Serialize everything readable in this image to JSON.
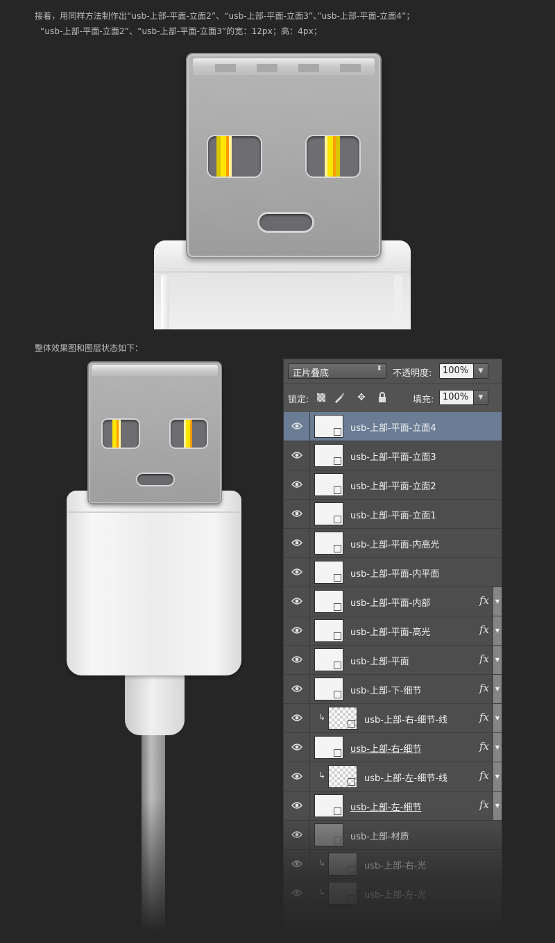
{
  "intro": {
    "line1": "接着，用同样方法制作出“usb-上部-平面-立面2”、“usb-上部-平面-立面3”、”usb-上部-平面-立面4”；",
    "line2": "“usb-上部-平面-立面2”、“usb-上部-平面-立面3”的宽：12px；高：4px；"
  },
  "caption": "整体效果图和图层状态如下：",
  "colors": {
    "background": "#262626",
    "panel": "#535353",
    "selected_row": "#6a7d95",
    "pin_yellow": "#ffe600",
    "pin_orange": "#ff9a00"
  },
  "layers_panel": {
    "blend_mode": "正片叠底",
    "opacity_label": "不透明度:",
    "opacity_value": "100%",
    "lock_label": "锁定:",
    "fill_label": "填充:",
    "fill_value": "100%",
    "lock_icons": [
      "lock-transparency-icon",
      "brush-icon",
      "move-icon",
      "padlock-icon"
    ],
    "layers": [
      {
        "name": "usb-上部-平面-立面4",
        "selected": true,
        "fx": false,
        "clipped": false,
        "thumb": "white"
      },
      {
        "name": "usb-上部-平面-立面3",
        "selected": false,
        "fx": false,
        "clipped": false,
        "thumb": "white"
      },
      {
        "name": "usb-上部-平面-立面2",
        "selected": false,
        "fx": false,
        "clipped": false,
        "thumb": "white"
      },
      {
        "name": "usb-上部-平面-立面1",
        "selected": false,
        "fx": false,
        "clipped": false,
        "thumb": "white"
      },
      {
        "name": "usb-上部-平面-内高光",
        "selected": false,
        "fx": false,
        "clipped": false,
        "thumb": "white"
      },
      {
        "name": "usb-上部-平面-内平面",
        "selected": false,
        "fx": false,
        "clipped": false,
        "thumb": "white"
      },
      {
        "name": "usb-上部-平面-内部",
        "selected": false,
        "fx": true,
        "clipped": false,
        "thumb": "white"
      },
      {
        "name": "usb-上部-平面-高光",
        "selected": false,
        "fx": true,
        "clipped": false,
        "thumb": "white"
      },
      {
        "name": "usb-上部-平面",
        "selected": false,
        "fx": true,
        "clipped": false,
        "thumb": "white"
      },
      {
        "name": "usb-上部-下-细节",
        "selected": false,
        "fx": true,
        "clipped": false,
        "thumb": "white"
      },
      {
        "name": "usb-上部-右-细节-线",
        "selected": false,
        "fx": true,
        "clipped": true,
        "thumb": "checker"
      },
      {
        "name": "usb-上部-右-细节",
        "selected": false,
        "fx": true,
        "clipped": false,
        "thumb": "white",
        "underline": true
      },
      {
        "name": "usb-上部-左-细节-线",
        "selected": false,
        "fx": true,
        "clipped": true,
        "thumb": "checker"
      },
      {
        "name": "usb-上部-左-细节",
        "selected": false,
        "fx": true,
        "clipped": false,
        "thumb": "white",
        "underline": true
      },
      {
        "name": "usb-上部-材质",
        "selected": false,
        "fx": false,
        "clipped": false,
        "thumb": "texture"
      },
      {
        "name": "usb-上部-右-光",
        "selected": false,
        "fx": false,
        "clipped": true,
        "thumb": "texture"
      },
      {
        "name": "usb-上部-左-光",
        "selected": false,
        "fx": false,
        "clipped": true,
        "thumb": "texture"
      }
    ]
  }
}
